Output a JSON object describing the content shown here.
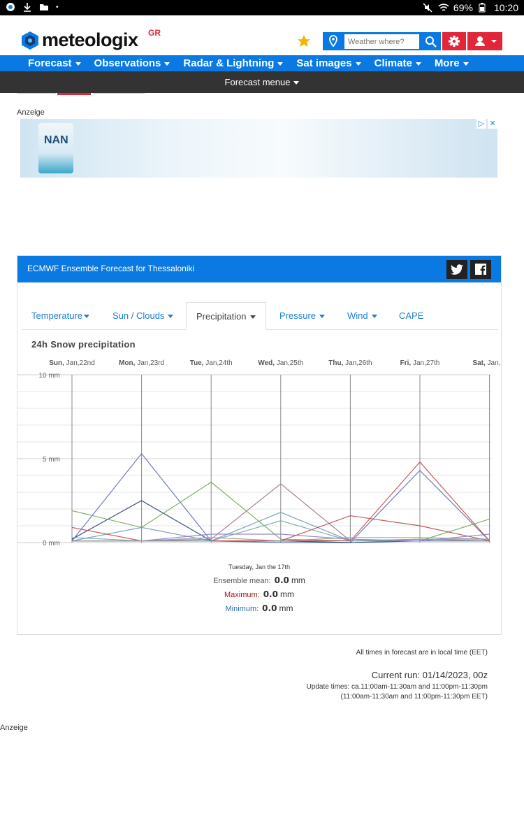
{
  "statusbar": {
    "battery": "69%",
    "time": "10:20"
  },
  "header": {
    "logo_text": "meteologix",
    "logo_suffix": "GR",
    "search_placeholder": "Weather where?"
  },
  "nav": {
    "items": [
      {
        "label": "Forecast"
      },
      {
        "label": "Observations"
      },
      {
        "label": "Radar & Lightning"
      },
      {
        "label": "Sat images"
      },
      {
        "label": "Climate"
      },
      {
        "label": "More"
      }
    ],
    "submenu": "Forecast menue"
  },
  "ads": {
    "label_top": "Anzeige",
    "label_bottom": "Anzeige",
    "product_text": "NAN"
  },
  "panel": {
    "title": "ECMWF Ensemble Forecast for Thessaloniki",
    "tabs": [
      {
        "label": "Temperature",
        "dropdown": true
      },
      {
        "label": "Sun / Clouds",
        "dropdown": true
      },
      {
        "label": "Precipitation",
        "dropdown": true,
        "active": true
      },
      {
        "label": "Pressure",
        "dropdown": true
      },
      {
        "label": "Wind",
        "dropdown": true
      },
      {
        "label": "CAPE",
        "dropdown": false
      }
    ],
    "chart_title": "24h Snow precipitation",
    "readout": {
      "date": "Tuesday, Jan the 17th",
      "mean_label": "Ensemble mean:",
      "mean_value": "0.0",
      "max_label": "Maximum:",
      "max_value": "0.0",
      "min_label": "Minimum:",
      "min_value": "0.0",
      "unit": "mm"
    }
  },
  "chart_data": {
    "type": "line",
    "title": "24h Snow precipitation",
    "y_unit": "mm",
    "ylim": [
      0,
      10
    ],
    "y_ticks": [
      "10 mm",
      "5 mm",
      "0 mm"
    ],
    "x_labels": [
      {
        "day": "Sun",
        "date": "Jan,22nd"
      },
      {
        "day": "Mon",
        "date": "Jan,23rd"
      },
      {
        "day": "Tue",
        "date": "Jan,24th"
      },
      {
        "day": "Wed",
        "date": "Jan,25th"
      },
      {
        "day": "Thu",
        "date": "Jan,26th"
      },
      {
        "day": "Fri",
        "date": "Jan,27th"
      },
      {
        "day": "Sat",
        "date": "Jan,..."
      }
    ],
    "x_days": [
      0,
      1,
      2,
      3,
      4,
      5,
      6
    ],
    "series": [
      {
        "color": "#5b6cb8",
        "values": [
          0.1,
          5.3,
          0.1,
          0.0,
          0.0,
          4.3,
          0.1
        ]
      },
      {
        "color": "#2a3f7a",
        "values": [
          0.2,
          2.5,
          0.1,
          0.1,
          0.0,
          0.1,
          0.1
        ]
      },
      {
        "color": "#6aa84f",
        "values": [
          1.9,
          0.9,
          3.6,
          0.2,
          0.1,
          0.1,
          1.4
        ]
      },
      {
        "color": "#a0728f",
        "values": [
          0.1,
          0.1,
          0.2,
          3.5,
          0.1,
          0.2,
          0.1
        ]
      },
      {
        "color": "#6f9ab5",
        "values": [
          0.1,
          0.9,
          0.1,
          1.8,
          0.1,
          0.1,
          0.1
        ]
      },
      {
        "color": "#b04a4a",
        "values": [
          0.1,
          0.1,
          0.1,
          0.1,
          1.6,
          1.0,
          0.1
        ]
      },
      {
        "color": "#c0504d",
        "values": [
          0.9,
          0.1,
          0.1,
          0.1,
          0.1,
          4.8,
          0.1
        ]
      },
      {
        "color": "#8e7cc3",
        "values": [
          0.1,
          0.1,
          0.5,
          0.5,
          0.2,
          0.1,
          0.5
        ]
      },
      {
        "color": "#76a5af",
        "values": [
          0.3,
          0.1,
          0.1,
          1.3,
          0.1,
          0.2,
          0.2
        ]
      },
      {
        "color": "#999999",
        "values": [
          0.1,
          0.1,
          0.3,
          0.1,
          0.3,
          0.3,
          0.2
        ]
      }
    ]
  },
  "footer": {
    "times_note": "All times in forecast are in local time (EET)",
    "current_run": "Current run: 01/14/2023, 00z",
    "update_times": "Update times: ca.11:00am-11:30am and 11:00pm-11:30pm",
    "update_times_eet": "(11:00am-11:30am and 11:00pm-11:30pm EET)"
  }
}
